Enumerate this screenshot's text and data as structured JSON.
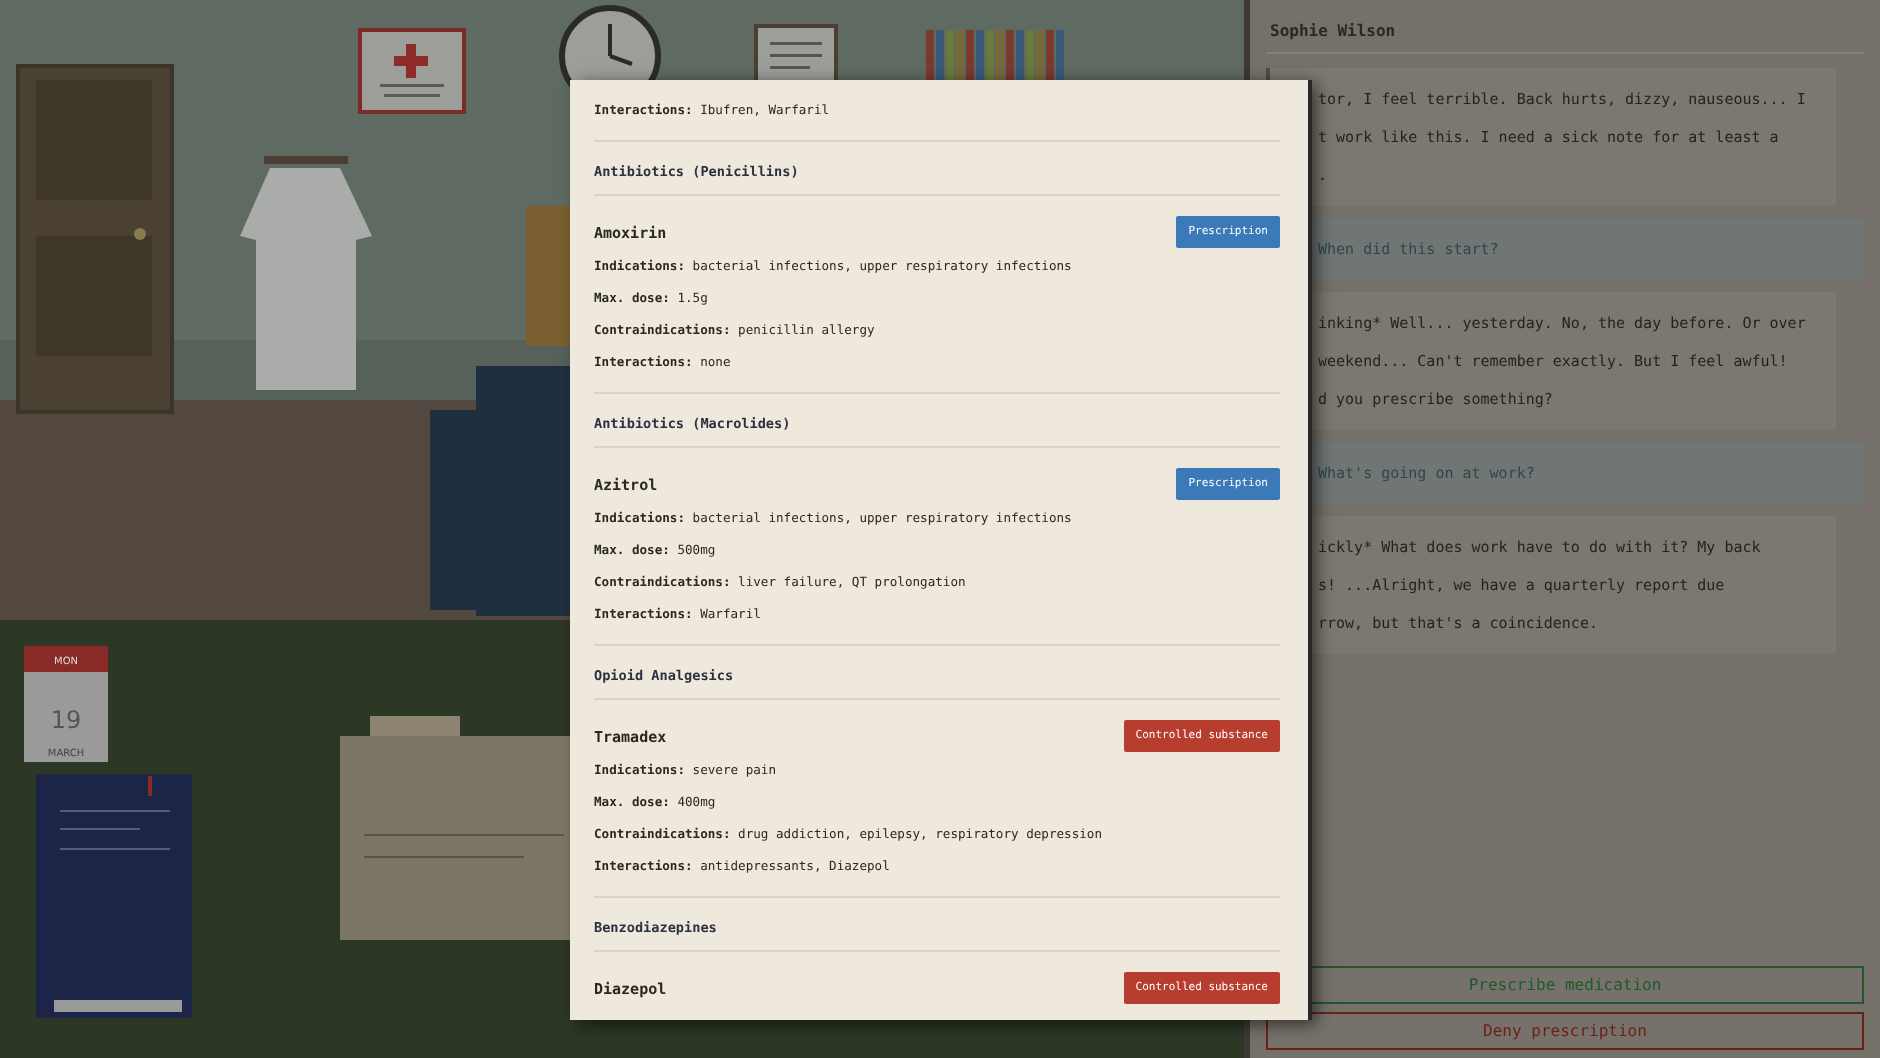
{
  "scene": {
    "calendar": {
      "day_name": "MON",
      "day": "19",
      "month": "MARCH"
    }
  },
  "reference": {
    "top_line": "**Interactions:** Ibufren, Warfaril",
    "groups": [
      {
        "category": "Antibiotics (Penicillins)",
        "drugs": [
          {
            "name": "Amoxirin",
            "kind": "prescription",
            "badge": "Prescription",
            "fields": [
              "**Indications:** bacterial infections, upper respiratory infections",
              "**Max. dose:** 1.5g",
              "**Contraindications:** penicillin allergy",
              "**Interactions:** none"
            ]
          }
        ]
      },
      {
        "category": "Antibiotics (Macrolides)",
        "drugs": [
          {
            "name": "Azitrol",
            "kind": "prescription",
            "badge": "Prescription",
            "fields": [
              "**Indications:** bacterial infections, upper respiratory infections",
              "**Max. dose:** 500mg",
              "**Contraindications:** liver failure, QT prolongation",
              "**Interactions:** Warfaril"
            ]
          }
        ]
      },
      {
        "category": "Opioid Analgesics",
        "drugs": [
          {
            "name": "Tramadex",
            "kind": "controlled",
            "badge": "Controlled substance",
            "fields": [
              "**Indications:** severe pain",
              "**Max. dose:** 400mg",
              "**Contraindications:** drug addiction, epilepsy, respiratory depression",
              "**Interactions:** antidepressants, Diazepol"
            ]
          }
        ]
      },
      {
        "category": "Benzodiazepines",
        "drugs": [
          {
            "name": "Diazepol",
            "kind": "controlled",
            "badge": "Controlled substance"
          }
        ]
      }
    ]
  },
  "chat": {
    "patient": "Sophie Wilson",
    "messages": [
      {
        "kind": "patient",
        "lines": [
          "tor, I feel terrible. Back hurts, dizzy, nauseous... I",
          "t work like this. I need a sick note for at least a",
          "."
        ]
      },
      {
        "kind": "doctor",
        "lines": [
          "When did this start?"
        ]
      },
      {
        "kind": "patient",
        "lines": [
          "inking* Well... yesterday. No, the day before. Or over",
          "weekend... Can't remember exactly. But I feel awful!",
          "d you prescribe something?"
        ]
      },
      {
        "kind": "doctor",
        "lines": [
          "What's going on at work?"
        ]
      },
      {
        "kind": "patient",
        "lines": [
          "ickly* What does work have to do with it? My back",
          "s! ...Alright, we have a quarterly report due",
          "rrow, but that's a coincidence."
        ]
      }
    ],
    "actions": [
      {
        "kind": "accept",
        "label": "Prescribe medication"
      },
      {
        "kind": "deny",
        "label": "Deny prescription"
      }
    ]
  }
}
